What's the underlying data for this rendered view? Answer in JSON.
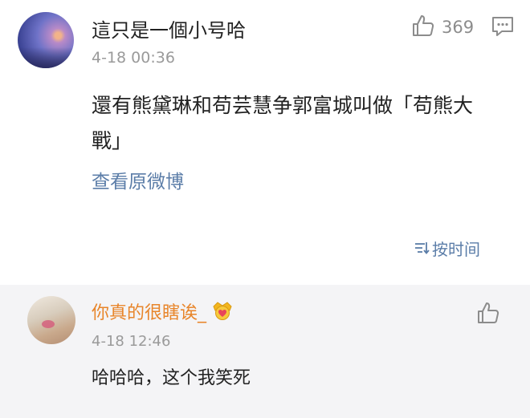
{
  "post": {
    "username": "這只是一個小号哈",
    "timestamp": "4-18 00:36",
    "like_count": "369",
    "body": "還有熊黛琳和苟芸慧争郭富城叫做「苟熊大戰」",
    "view_original_label": "查看原微博",
    "sort_label": "按时间",
    "icons": {
      "like": "thumbs-up-icon",
      "reply": "comment-bubble-icon",
      "sort": "sort-list-icon"
    }
  },
  "comment": {
    "username": "你真的很瞎诶_",
    "timestamp": "4-18 12:46",
    "text": "哈哈哈，这个我笑死",
    "icons": {
      "badge": "crown-heart-badge-icon",
      "like": "thumbs-up-icon"
    }
  },
  "colors": {
    "link": "#5b7da8",
    "username_highlight": "#e8852a",
    "comment_bg": "#f4f4f6",
    "muted": "#9a9a9a"
  }
}
